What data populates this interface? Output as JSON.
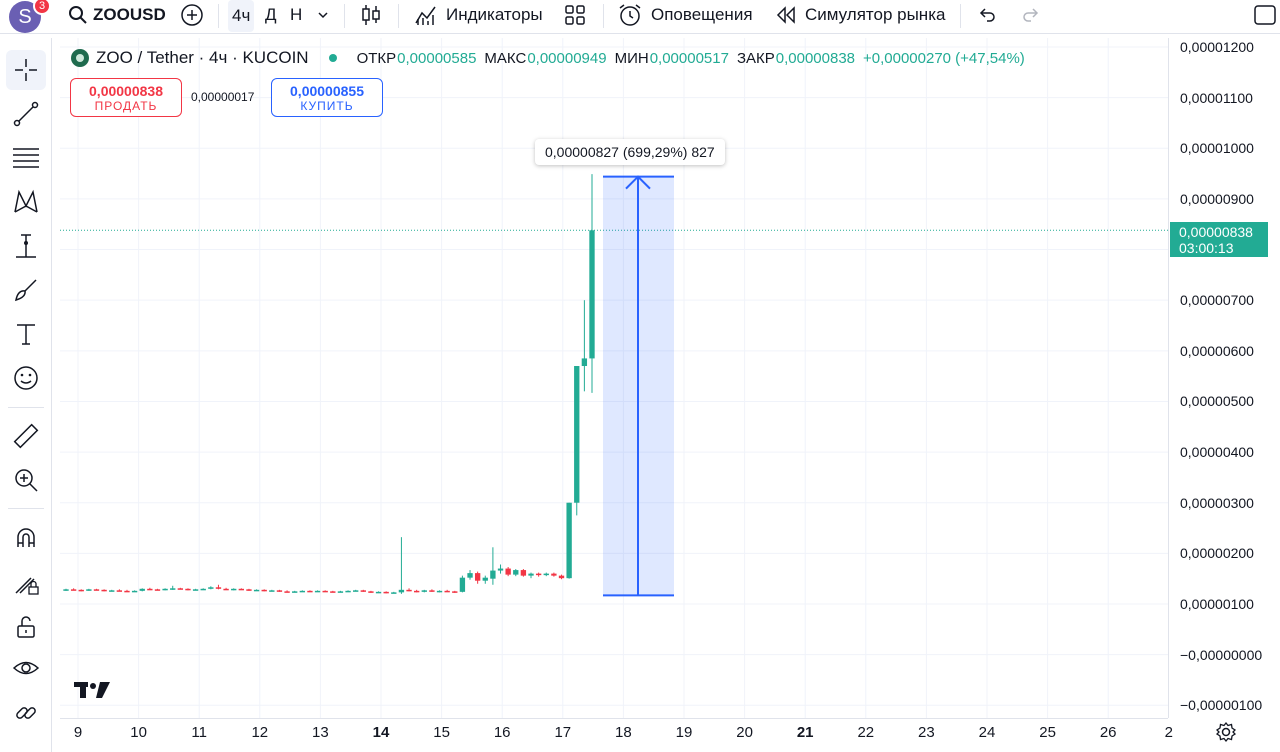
{
  "topbar": {
    "notification_count": "3",
    "avatar_letter": "S",
    "symbol": "ZOOUSD",
    "intervals": [
      "4ч",
      "Д",
      "Н"
    ],
    "indicators_label": "Индикаторы",
    "alerts_label": "Оповещения",
    "replay_label": "Симулятор рынка"
  },
  "legend": {
    "title": "ZOO / Tether · 4ч · KUCOIN",
    "open_label": "ОТКР",
    "open": "0,00000585",
    "high_label": "МАКС",
    "high": "0,00000949",
    "low_label": "МИН",
    "low": "0,00000517",
    "close_label": "ЗАКР",
    "close": "0,00000838",
    "change": "+0,00000270 (+47,54%)"
  },
  "trade": {
    "sell_price": "0,00000838",
    "sell_label": "ПРОДАТЬ",
    "spread": "0,00000017",
    "buy_price": "0,00000855",
    "buy_label": "КУПИТЬ"
  },
  "measure_tooltip": "0,00000827 (699,29%) 827",
  "price_scale": {
    "labels": [
      "0,00001200",
      "0,00001100",
      "0,00001000",
      "0,00000900",
      "0,00000700",
      "0,00000600",
      "0,00000500",
      "0,00000400",
      "0,00000300",
      "0,00000200",
      "0,00000100",
      "−0,00000000",
      "−0,00000100"
    ],
    "current_price": "0,00000838",
    "countdown": "03:00:13"
  },
  "time_scale": {
    "labels": [
      {
        "t": "9",
        "bold": false
      },
      {
        "t": "10",
        "bold": false
      },
      {
        "t": "11",
        "bold": false
      },
      {
        "t": "12",
        "bold": false
      },
      {
        "t": "13",
        "bold": false
      },
      {
        "t": "14",
        "bold": true
      },
      {
        "t": "15",
        "bold": false
      },
      {
        "t": "16",
        "bold": false
      },
      {
        "t": "17",
        "bold": false
      },
      {
        "t": "18",
        "bold": false
      },
      {
        "t": "19",
        "bold": false
      },
      {
        "t": "20",
        "bold": false
      },
      {
        "t": "21",
        "bold": true
      },
      {
        "t": "22",
        "bold": false
      },
      {
        "t": "23",
        "bold": false
      },
      {
        "t": "24",
        "bold": false
      },
      {
        "t": "25",
        "bold": false
      },
      {
        "t": "26",
        "bold": false
      },
      {
        "t": "2",
        "bold": false
      }
    ]
  },
  "colors": {
    "up": "#22ab94",
    "down": "#f23645",
    "accent": "#2962ff"
  },
  "chart_data": {
    "type": "candlestick",
    "candles": [
      [
        1.28e-06,
        1.3e-06,
        1.26e-06,
        1.29e-06
      ],
      [
        1.29e-06,
        1.31e-06,
        1.27e-06,
        1.28e-06
      ],
      [
        1.28e-06,
        1.29e-06,
        1.25e-06,
        1.27e-06
      ],
      [
        1.27e-06,
        1.3e-06,
        1.26e-06,
        1.29e-06
      ],
      [
        1.29e-06,
        1.3e-06,
        1.27e-06,
        1.28e-06
      ],
      [
        1.28e-06,
        1.29e-06,
        1.25e-06,
        1.26e-06
      ],
      [
        1.26e-06,
        1.28e-06,
        1.25e-06,
        1.27e-06
      ],
      [
        1.27e-06,
        1.29e-06,
        1.25e-06,
        1.26e-06
      ],
      [
        1.26e-06,
        1.28e-06,
        1.24e-06,
        1.25e-06
      ],
      [
        1.25e-06,
        1.27e-06,
        1.24e-06,
        1.26e-06
      ],
      [
        1.26e-06,
        1.31e-06,
        1.25e-06,
        1.3e-06
      ],
      [
        1.3e-06,
        1.32e-06,
        1.28e-06,
        1.29e-06
      ],
      [
        1.29e-06,
        1.3e-06,
        1.27e-06,
        1.28e-06
      ],
      [
        1.28e-06,
        1.31e-06,
        1.27e-06,
        1.3e-06
      ],
      [
        1.3e-06,
        1.36e-06,
        1.28e-06,
        1.31e-06
      ],
      [
        1.31e-06,
        1.32e-06,
        1.29e-06,
        1.3e-06
      ],
      [
        1.3e-06,
        1.31e-06,
        1.27e-06,
        1.28e-06
      ],
      [
        1.28e-06,
        1.3e-06,
        1.27e-06,
        1.29e-06
      ],
      [
        1.29e-06,
        1.31e-06,
        1.28e-06,
        1.3e-06
      ],
      [
        1.3e-06,
        1.35e-06,
        1.29e-06,
        1.33e-06
      ],
      [
        1.33e-06,
        1.38e-06,
        1.29e-06,
        1.3e-06
      ],
      [
        1.3e-06,
        1.32e-06,
        1.28e-06,
        1.29e-06
      ],
      [
        1.29e-06,
        1.31e-06,
        1.27e-06,
        1.3e-06
      ],
      [
        1.3e-06,
        1.31e-06,
        1.28e-06,
        1.29e-06
      ],
      [
        1.29e-06,
        1.3e-06,
        1.26e-06,
        1.27e-06
      ],
      [
        1.27e-06,
        1.29e-06,
        1.26e-06,
        1.28e-06
      ],
      [
        1.28e-06,
        1.29e-06,
        1.25e-06,
        1.26e-06
      ],
      [
        1.26e-06,
        1.28e-06,
        1.25e-06,
        1.27e-06
      ],
      [
        1.27e-06,
        1.28e-06,
        1.24e-06,
        1.25e-06
      ],
      [
        1.25e-06,
        1.27e-06,
        1.23e-06,
        1.24e-06
      ],
      [
        1.24e-06,
        1.26e-06,
        1.23e-06,
        1.25e-06
      ],
      [
        1.25e-06,
        1.27e-06,
        1.24e-06,
        1.26e-06
      ],
      [
        1.26e-06,
        1.27e-06,
        1.24e-06,
        1.25e-06
      ],
      [
        1.25e-06,
        1.27e-06,
        1.24e-06,
        1.26e-06
      ],
      [
        1.26e-06,
        1.27e-06,
        1.24e-06,
        1.25e-06
      ],
      [
        1.25e-06,
        1.26e-06,
        1.23e-06,
        1.24e-06
      ],
      [
        1.24e-06,
        1.26e-06,
        1.23e-06,
        1.25e-06
      ],
      [
        1.25e-06,
        1.27e-06,
        1.24e-06,
        1.26e-06
      ],
      [
        1.26e-06,
        1.28e-06,
        1.25e-06,
        1.27e-06
      ],
      [
        1.27e-06,
        1.28e-06,
        1.24e-06,
        1.25e-06
      ],
      [
        1.25e-06,
        1.26e-06,
        1.22e-06,
        1.23e-06
      ],
      [
        1.23e-06,
        1.25e-06,
        1.22e-06,
        1.24e-06
      ],
      [
        1.24e-06,
        1.25e-06,
        1.21e-06,
        1.22e-06
      ],
      [
        1.22e-06,
        1.24e-06,
        1.21e-06,
        1.23e-06
      ],
      [
        1.23e-06,
        2.32e-06,
        1.2e-06,
        1.28e-06
      ],
      [
        1.28e-06,
        1.31e-06,
        1.25e-06,
        1.26e-06
      ],
      [
        1.26e-06,
        1.28e-06,
        1.23e-06,
        1.24e-06
      ],
      [
        1.24e-06,
        1.28e-06,
        1.23e-06,
        1.27e-06
      ],
      [
        1.27e-06,
        1.29e-06,
        1.24e-06,
        1.25e-06
      ],
      [
        1.25e-06,
        1.27e-06,
        1.23e-06,
        1.26e-06
      ],
      [
        1.26e-06,
        1.28e-06,
        1.24e-06,
        1.25e-06
      ],
      [
        1.25e-06,
        1.26e-06,
        1.22e-06,
        1.24e-06
      ],
      [
        1.24e-06,
        1.56e-06,
        1.23e-06,
        1.52e-06
      ],
      [
        1.52e-06,
        1.67e-06,
        1.48e-06,
        1.61e-06
      ],
      [
        1.61e-06,
        1.64e-06,
        1.4e-06,
        1.46e-06
      ],
      [
        1.46e-06,
        1.56e-06,
        1.4e-06,
        1.52e-06
      ],
      [
        1.5e-06,
        2.12e-06,
        1.38e-06,
        1.66e-06
      ],
      [
        1.66e-06,
        1.78e-06,
        1.6e-06,
        1.7e-06
      ],
      [
        1.7e-06,
        1.73e-06,
        1.55e-06,
        1.58e-06
      ],
      [
        1.58e-06,
        1.69e-06,
        1.55e-06,
        1.67e-06
      ],
      [
        1.67e-06,
        1.69e-06,
        1.54e-06,
        1.56e-06
      ],
      [
        1.56e-06,
        1.62e-06,
        1.51e-06,
        1.6e-06
      ],
      [
        1.6e-06,
        1.62e-06,
        1.54e-06,
        1.57e-06
      ],
      [
        1.57e-06,
        1.62e-06,
        1.55e-06,
        1.6e-06
      ],
      [
        1.6e-06,
        1.62e-06,
        1.54e-06,
        1.56e-06
      ],
      [
        1.56e-06,
        1.58e-06,
        1.49e-06,
        1.51e-06
      ],
      [
        1.51e-06,
        3e-06,
        1.5e-06,
        3e-06
      ],
      [
        3e-06,
        4.4e-06,
        2.75e-06,
        5.7e-06
      ],
      [
        5.7e-06,
        7e-06,
        5.2e-06,
        5.85e-06
      ],
      [
        5.85e-06,
        9.49e-06,
        5.17e-06,
        8.38e-06
      ]
    ],
    "measure": {
      "from_price": 1.17e-06,
      "to_price": 9.44e-06,
      "label": "0,00000827 (699,29%) 827"
    },
    "ylim": [
      -1.2e-06,
      1.23e-05
    ]
  }
}
